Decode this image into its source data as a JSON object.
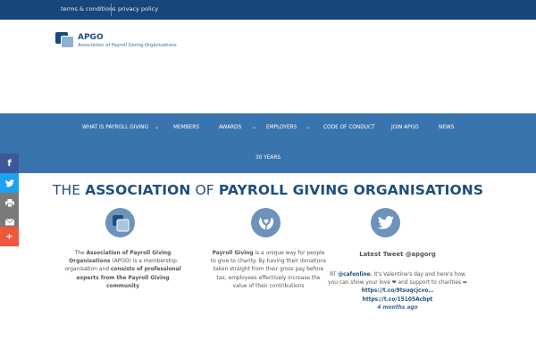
{
  "topbar": {
    "terms": "terms & conditions",
    "privacy": "privacy policy"
  },
  "logo": {
    "title": "APGO",
    "subtitle": "Association of Payroll Giving Organisations"
  },
  "nav": {
    "items": [
      {
        "label": "WHAT IS PAYROLL GIVING",
        "has_dropdown": true
      },
      {
        "label": "MEMBERS",
        "has_dropdown": false
      },
      {
        "label": "AWARDS",
        "has_dropdown": true
      },
      {
        "label": "EMPLOYERS",
        "has_dropdown": true
      },
      {
        "label": "CODE OF CONDUCT",
        "has_dropdown": false
      },
      {
        "label": "JOIN APGO",
        "has_dropdown": false
      },
      {
        "label": "NEWS",
        "has_dropdown": false
      },
      {
        "label": "30 YEARS",
        "has_dropdown": false
      }
    ]
  },
  "social": [
    {
      "icon": "facebook-icon",
      "glyph": "f",
      "color": "#3b5998"
    },
    {
      "icon": "twitter-icon",
      "glyph": "",
      "color": "#1da1f2"
    },
    {
      "icon": "print-icon",
      "glyph": "",
      "color": "#7a7a7a"
    },
    {
      "icon": "email-icon",
      "glyph": "",
      "color": "#7a7a7a"
    },
    {
      "icon": "plus-icon",
      "glyph": "+",
      "color": "#f0573c"
    }
  ],
  "headline": {
    "p1": "THE ",
    "p2": "ASSOCIATION",
    "p3": " OF ",
    "p4": "PAYROLL GIVING ORGANISATIONS"
  },
  "col1": {
    "t1": "The ",
    "b1": "Association of Payroll Giving Organisations",
    "t2": " (APGO) is a membership organisation and ",
    "b2": "consists of professional experts from the Payroll Giving community"
  },
  "col2": {
    "b1": "Payroll Giving",
    "t1": " is a unique way for people to give to charity. By having their donations taken straight from their gross pay before tax, employees effectively increase the value of their contributions"
  },
  "tweet": {
    "heading": "Latest Tweet @apgorg",
    "prefix": "RT ",
    "handle": "@cafonline",
    "body": ": It's Valentine's day and here's how you can show your love ❤ and support to charities ➡ ",
    "link1": "https://t.co/9tsuqcjcvo…",
    "link2": "https://t.co/15105Acbpt",
    "ago": "4 months ago"
  },
  "colors": {
    "topbar": "#16467a",
    "nav": "#3a74ae",
    "heading": "#1e4f7d",
    "icon_circle": "#6d93bc"
  }
}
